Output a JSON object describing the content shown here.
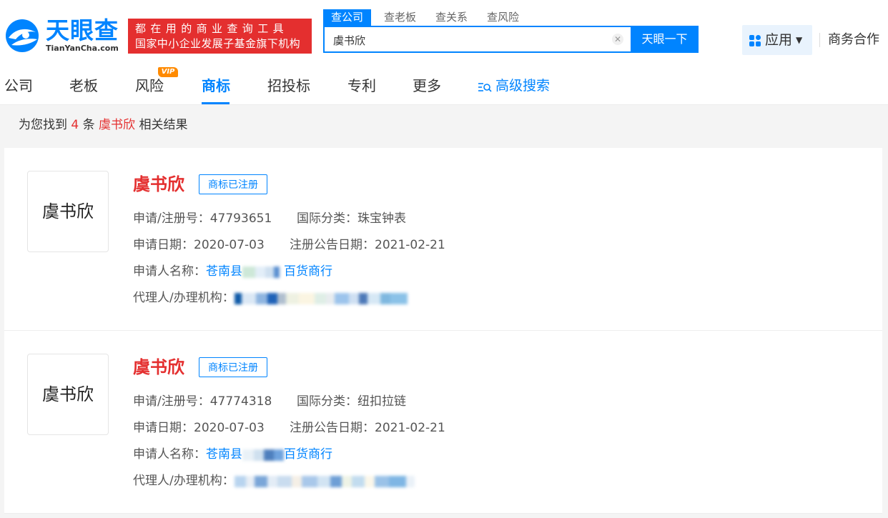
{
  "brand": {
    "name_cn": "天眼查",
    "name_en": "TianYanCha.com",
    "slogan_line1": "都在用的商业查询工具",
    "slogan_line2": "国家中小企业发展子基金旗下机构",
    "colors": {
      "primary": "#0084ff",
      "red": "#e42f2f",
      "vip": "#ff8a00"
    }
  },
  "search": {
    "tabs": [
      "查公司",
      "查老板",
      "查关系",
      "查风险"
    ],
    "active_tab": "查公司",
    "query": "虞书欣",
    "clear_icon": "close-icon",
    "button_label": "天眼一下"
  },
  "header": {
    "apps_label": "应用",
    "apps_icon": "grid-icon",
    "business_label": "商务合作"
  },
  "nav": {
    "items": [
      "公司",
      "老板",
      "风险",
      "商标",
      "招投标",
      "专利",
      "更多"
    ],
    "active": "商标",
    "vip_badge": "VIP",
    "advanced_search_label": "高级搜索",
    "advanced_search_icon": "filter-search-icon"
  },
  "results": {
    "prefix": "为您找到",
    "count": "4",
    "middle": "条",
    "keyword": "虞书欣",
    "suffix": "相关结果",
    "items": [
      {
        "thumb_text": "虞书欣",
        "name": "虞书欣",
        "status": "商标已注册",
        "reg_no_label": "申请/注册号：",
        "reg_no": "47793651",
        "class_label": "国际分类：",
        "class": "珠宝钟表",
        "apply_date_label": "申请日期：",
        "apply_date": "2020-07-03",
        "announce_label": "注册公告日期：",
        "announce_date": "2021-02-21",
        "applicant_label": "申请人名称：",
        "applicant_start": "苍南县",
        "applicant_end": "百货商行",
        "agent_label": "代理人/办理机构："
      },
      {
        "thumb_text": "虞书欣",
        "name": "虞书欣",
        "status": "商标已注册",
        "reg_no_label": "申请/注册号：",
        "reg_no": "47774318",
        "class_label": "国际分类：",
        "class": "纽扣拉链",
        "apply_date_label": "申请日期：",
        "apply_date": "2020-07-03",
        "announce_label": "注册公告日期：",
        "announce_date": "2021-02-21",
        "applicant_label": "申请人名称：",
        "applicant_start": "苍南县",
        "applicant_end": "百货商行",
        "agent_label": "代理人/办理机构："
      }
    ]
  }
}
